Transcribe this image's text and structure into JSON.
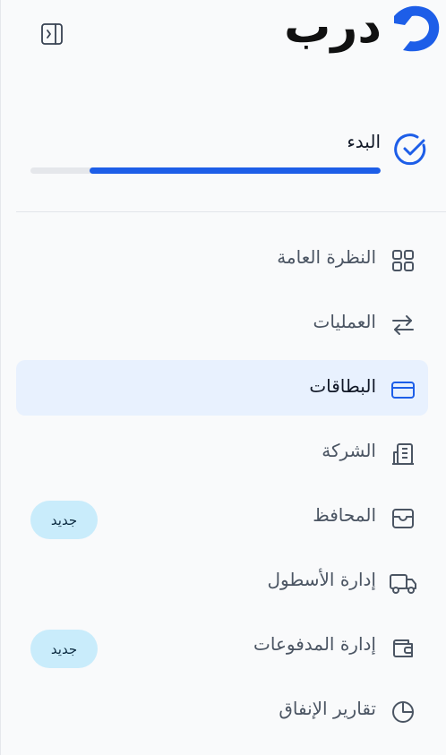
{
  "header": {
    "logo_text": "درب",
    "brand_color": "#1d5ee8"
  },
  "onboarding": {
    "label": "البدء",
    "progress_fraction": 0.83
  },
  "nav": {
    "items": [
      {
        "label": "النظرة العامة",
        "icon": "grid-icon",
        "active": false
      },
      {
        "label": "العمليات",
        "icon": "transfer-arrows-icon",
        "active": false
      },
      {
        "label": "البطاقات",
        "icon": "card-icon",
        "active": true
      },
      {
        "label": "الشركة",
        "icon": "building-icon",
        "active": false
      },
      {
        "label": "المحافظ",
        "icon": "wallet-box-icon",
        "active": false,
        "badge": "جديد"
      },
      {
        "label": "إدارة الأسطول",
        "icon": "truck-icon",
        "active": false
      },
      {
        "label": "إدارة المدفوعات",
        "icon": "wallet-icon",
        "active": false,
        "badge": "جديد"
      },
      {
        "label": "تقارير الإنفاق",
        "icon": "pie-chart-icon",
        "active": false
      }
    ]
  }
}
